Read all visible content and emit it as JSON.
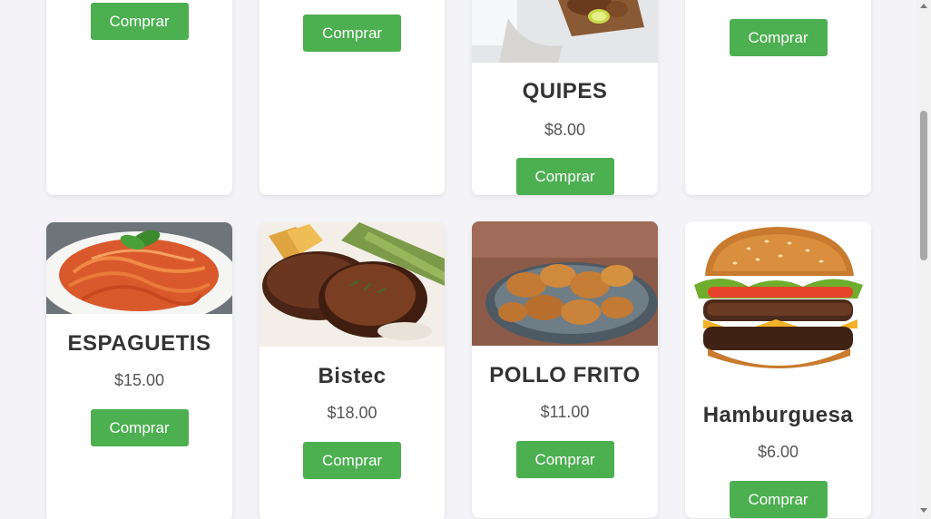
{
  "products_row1": [
    {
      "button": "Comprar"
    },
    {
      "button": "Comprar"
    },
    {
      "name": "QUIPES",
      "price": "$8.00",
      "button": "Comprar",
      "image": "kibbeh-photo"
    },
    {
      "button": "Comprar"
    }
  ],
  "products_row2": [
    {
      "name": "ESPAGUETIS",
      "price": "$15.00",
      "button": "Comprar",
      "image": "spaghetti-photo"
    },
    {
      "name": "Bistec",
      "price": "$18.00",
      "button": "Comprar",
      "image": "steak-photo"
    },
    {
      "name": "POLLO FRITO",
      "price": "$11.00",
      "button": "Comprar",
      "image": "fried-chicken-photo"
    },
    {
      "name": "Hamburguesa",
      "price": "$6.00",
      "button": "Comprar",
      "image": "hamburger-photo"
    }
  ],
  "colors": {
    "button": "#4caf50",
    "background": "#f4f4f8",
    "card": "#ffffff"
  }
}
